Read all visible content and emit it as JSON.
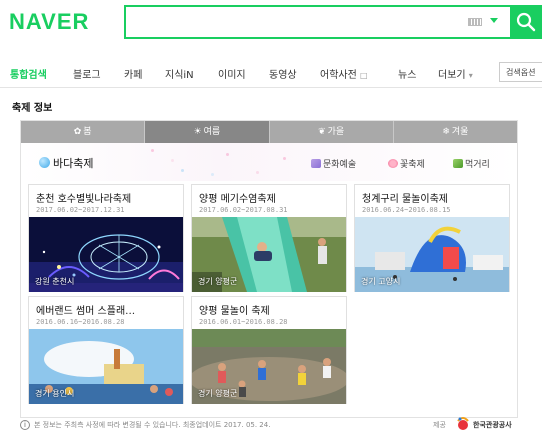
{
  "header": {
    "logo": "NAVER",
    "search": {
      "value": "",
      "placeholder": ""
    }
  },
  "nav": {
    "items": [
      {
        "label": "통합검색",
        "active": true
      },
      {
        "label": "블로그"
      },
      {
        "label": "카페"
      },
      {
        "label": "지식iN"
      },
      {
        "label": "이미지"
      },
      {
        "label": "동영상"
      },
      {
        "label": "어학사전"
      },
      {
        "label": "뉴스"
      },
      {
        "label": "더보기"
      }
    ],
    "options_label": "검색옵션"
  },
  "section": {
    "title": "축제 정보"
  },
  "seasons": [
    {
      "label": "봄",
      "icon": "flower-icon"
    },
    {
      "label": "여름",
      "icon": "sun-icon",
      "active": true
    },
    {
      "label": "가을",
      "icon": "leaf-icon"
    },
    {
      "label": "겨울",
      "icon": "snowflake-icon"
    }
  ],
  "themes": {
    "active": "바다축제",
    "options": [
      "문화예술",
      "꽃축제",
      "먹거리"
    ]
  },
  "festivals": [
    {
      "title": "춘천 호수별빛나라축제",
      "date": "2017.06.02~2017.12.31",
      "location": "강원 춘천시",
      "image": "night-lights"
    },
    {
      "title": "양평 메기수염축제",
      "date": "2017.06.02~2017.08.31",
      "location": "경기 양평군",
      "image": "water-slide"
    },
    {
      "title": "청계구리 물놀이축제",
      "date": "2016.06.24~2016.08.15",
      "location": "경기 고양시",
      "image": "inflatable-pool"
    },
    {
      "title": "에버랜드 썸머 스플래…",
      "date": "2016.06.16~2016.08.28",
      "location": "경기 용인시",
      "image": "water-park"
    },
    {
      "title": "양평 물놀이 축제",
      "date": "2016.06.01~2016.08.28",
      "location": "경기 양평군",
      "image": "stream-play"
    }
  ],
  "footer": {
    "notice": "본 정보는 주최측 사정에 따라 변경될 수 있습니다. 최종업데이트 2017. 05. 24.",
    "provider_label": "제공",
    "provider_name": "한국관광공사"
  },
  "colors": {
    "brand": "#19ce60",
    "tab_bg": "#a9a9a9",
    "tab_active": "#878787"
  }
}
